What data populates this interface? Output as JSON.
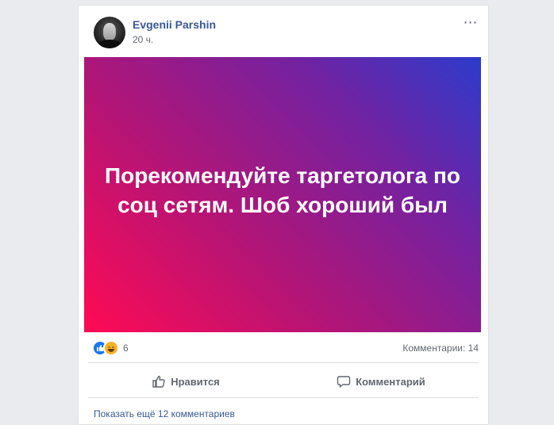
{
  "post": {
    "author": "Evgenii Parshin",
    "time": "20 ч.",
    "text": "Порекомендуйте таргетолога по соц сетям. Шоб хороший был",
    "banner_colors": [
      "#ff0a54",
      "#b21577",
      "#7322a1",
      "#2c3bcc"
    ],
    "more_icon": "ellipsis-icon"
  },
  "reactions": {
    "icons": [
      "like-icon",
      "haha-icon"
    ],
    "count": "6",
    "comments_label": "Комментарии: 14"
  },
  "actions": {
    "like_label": "Нравится",
    "comment_label": "Комментарий"
  },
  "footer": {
    "more_comments": "Показать ещё 12 комментариев"
  },
  "colors": {
    "link": "#385898",
    "muted": "#606770",
    "like_blue": "#1877f2",
    "haha_yellow": "#f7b125"
  }
}
